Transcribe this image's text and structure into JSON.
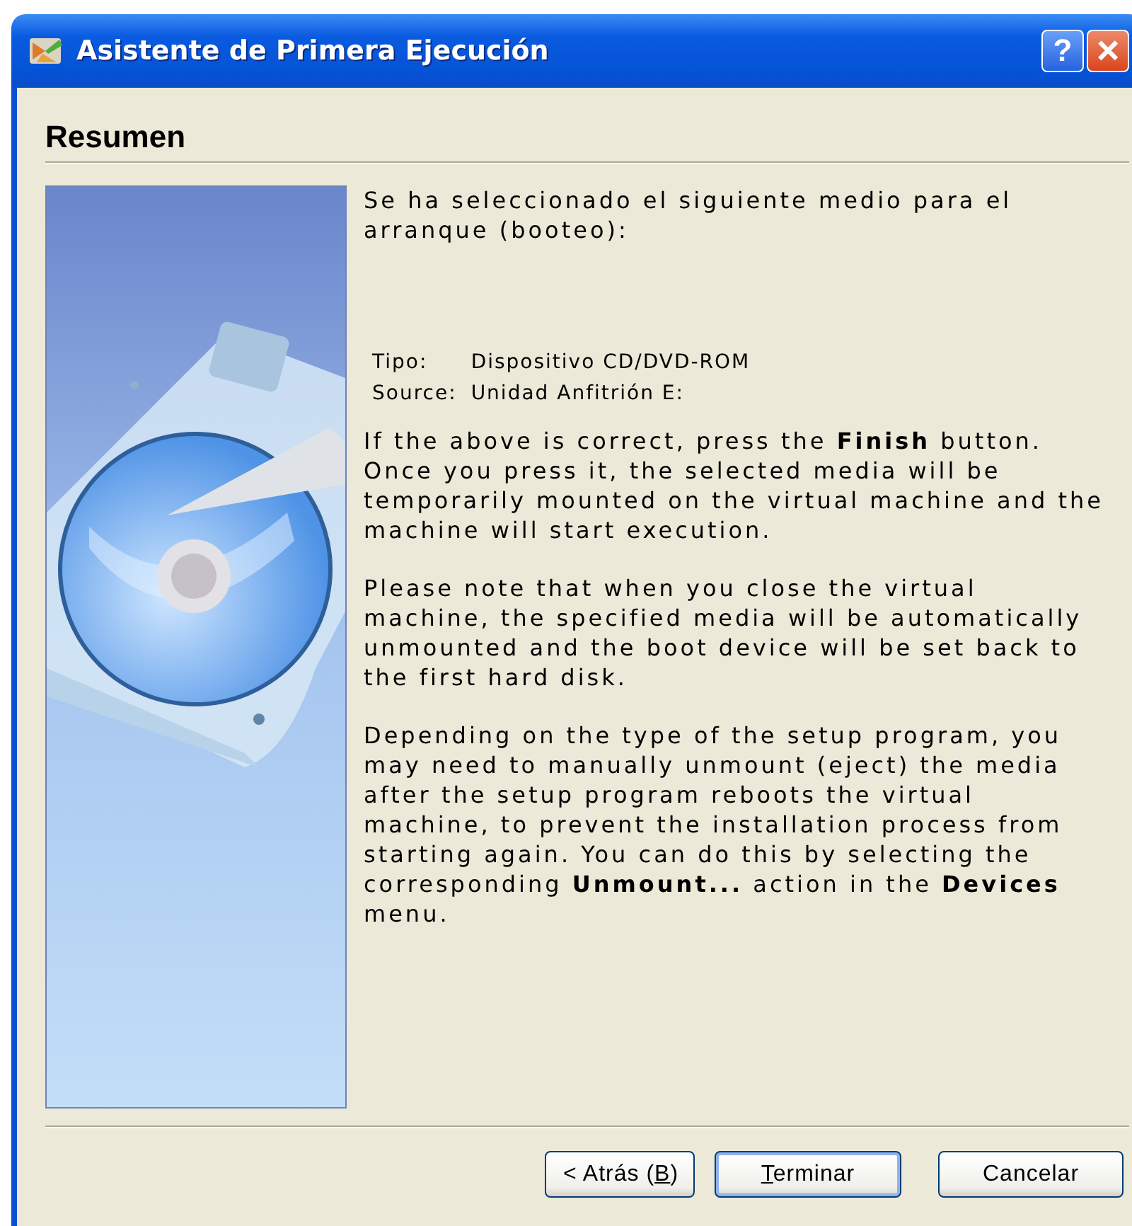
{
  "window": {
    "title": "Asistente de Primera Ejecución",
    "help_button": "?",
    "close_button": "×"
  },
  "page": {
    "heading": "Resumen",
    "intro": "Se ha seleccionado el siguiente medio para el arranque (booteo):",
    "details": [
      {
        "label": "Tipo:",
        "value": "Dispositivo CD/DVD-ROM"
      },
      {
        "label": "Source:",
        "value": "Unidad Anfitrión E:"
      }
    ],
    "paragraphs": [
      "If the above is correct, press the **Finish** button. Once you press it, the selected media will be temporarily mounted on the virtual machine and the machine will start execution.",
      "Please note that when you close the virtual machine, the specified media will be automatically unmounted and the boot device will be set back to the first hard disk.",
      "Depending on the type of the setup program, you may need to manually unmount (eject) the media after the setup program reboots the virtual machine, to prevent the installation process from starting again. You can do this by selecting the corresponding **Unmount...** action in the **Devices** menu."
    ]
  },
  "buttons": [
    {
      "before": "< Atrás (",
      "key": "B",
      "after": ")",
      "default": false
    },
    {
      "key": "T",
      "after": "erminar",
      "default": true
    },
    {
      "before": "Cancelar",
      "default": false
    }
  ]
}
